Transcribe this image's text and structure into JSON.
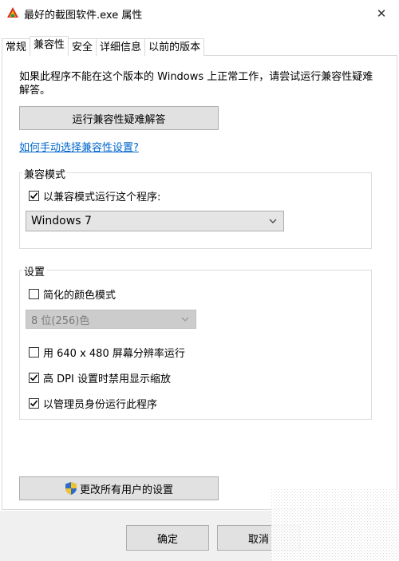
{
  "window": {
    "title": "最好的截图软件.exe 属性",
    "close_glyph": "✕"
  },
  "tabs": [
    {
      "label": "常规",
      "active": false
    },
    {
      "label": "兼容性",
      "active": true
    },
    {
      "label": "安全",
      "active": false
    },
    {
      "label": "详细信息",
      "active": false
    },
    {
      "label": "以前的版本",
      "active": false
    }
  ],
  "compat": {
    "description": "如果此程序不能在这个版本的 Windows 上正常工作，请尝试运行兼容性疑难解答。",
    "troubleshoot_button": "运行兼容性疑难解答",
    "manual_link": "如何手动选择兼容性设置?",
    "mode_group": {
      "legend": "兼容模式",
      "checkbox_label": "以兼容模式运行这个程序:",
      "checked": true,
      "os_selected": "Windows 7"
    },
    "settings_group": {
      "legend": "设置",
      "items": [
        {
          "label": "简化的颜色模式",
          "checked": false
        },
        {
          "label": "用 640 x 480 屏幕分辨率运行",
          "checked": false
        },
        {
          "label": "高 DPI 设置时禁用显示缩放",
          "checked": true
        },
        {
          "label": "以管理员身份运行此程序",
          "checked": true
        }
      ],
      "color_select": "8 位(256)色",
      "color_select_enabled": false
    },
    "all_users_button": "更改所有用户的设置"
  },
  "footer": {
    "ok_button": "确定",
    "cancel_button": "取消"
  },
  "colors": {
    "link": "#0066cc",
    "button_bg": "#e1e1e1",
    "footer_bg": "#f0f0f0",
    "shield_blue": "#2f6cc4",
    "shield_yellow": "#f2c12e"
  },
  "icons": {
    "app": "app-icon",
    "close": "close-icon",
    "check": "checkmark-icon",
    "dropdown": "chevron-down-icon",
    "uac": "uac-shield-icon"
  }
}
